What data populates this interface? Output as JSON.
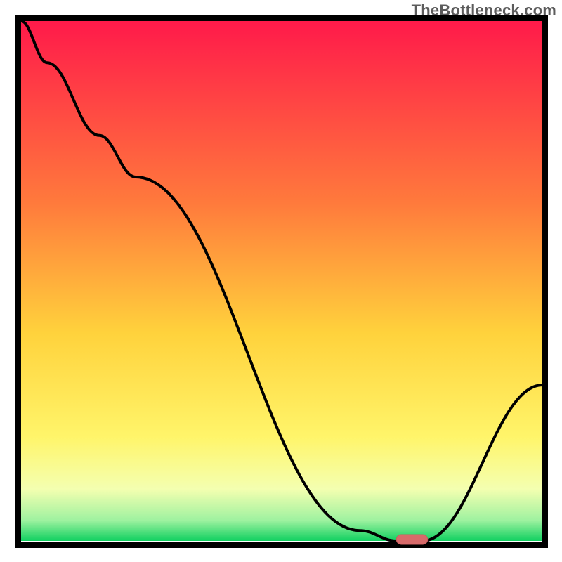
{
  "watermark": "TheBottleneck.com",
  "colors": {
    "grad_top": "#ff1a4a",
    "grad_upper_mid": "#ff7a3c",
    "grad_mid": "#ffd23c",
    "grad_lower_mid": "#fff56a",
    "grad_low": "#f4ffb0",
    "grad_green_light": "#9ff2a0",
    "grad_green": "#10d060",
    "axis": "#000000",
    "curve": "#000000",
    "marker_fill": "#d76a6a",
    "marker_stroke": "#c95c5c"
  },
  "chart_data": {
    "type": "line",
    "title": "",
    "xlabel": "",
    "ylabel": "",
    "xlim": [
      0,
      100
    ],
    "ylim": [
      0,
      100
    ],
    "annotations": [],
    "x": [
      0,
      5,
      15,
      22,
      65,
      72,
      77,
      100
    ],
    "values": [
      100,
      92,
      78,
      70,
      2,
      0,
      0,
      30
    ],
    "marker": {
      "x_start": 72,
      "x_end": 78,
      "y": 0
    }
  }
}
